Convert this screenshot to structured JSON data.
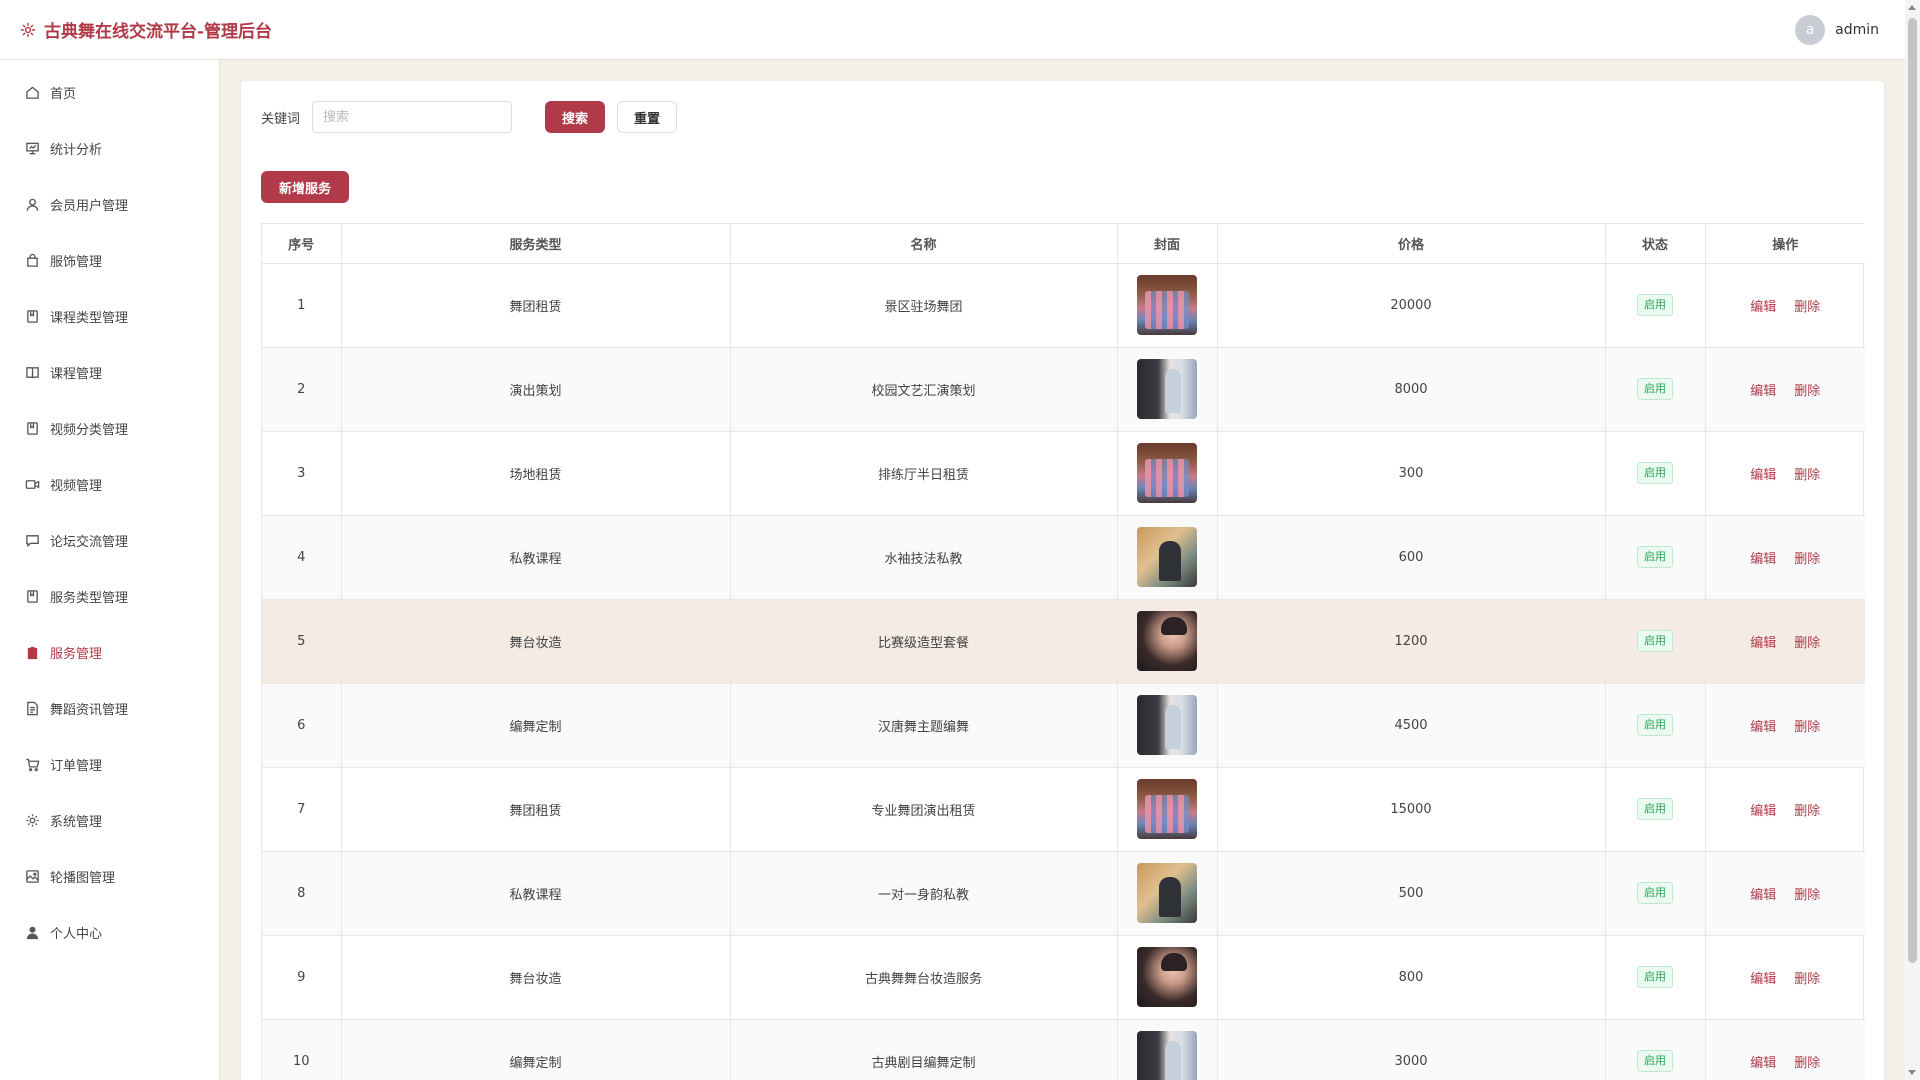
{
  "app": {
    "title": "古典舞在线交流平台-管理后台",
    "user": {
      "avatar_letter": "a",
      "name": "admin"
    },
    "accent_color": "#b03a48"
  },
  "sidebar": {
    "items": [
      {
        "label": "首页",
        "icon": "home-icon"
      },
      {
        "label": "统计分析",
        "icon": "chart-icon"
      },
      {
        "label": "会员用户管理",
        "icon": "user-icon"
      },
      {
        "label": "服饰管理",
        "icon": "bag-icon"
      },
      {
        "label": "课程类型管理",
        "icon": "bookmark-icon"
      },
      {
        "label": "课程管理",
        "icon": "book-icon"
      },
      {
        "label": "视频分类管理",
        "icon": "bookmark-icon"
      },
      {
        "label": "视频管理",
        "icon": "video-icon"
      },
      {
        "label": "论坛交流管理",
        "icon": "chat-icon"
      },
      {
        "label": "服务类型管理",
        "icon": "bookmark-icon"
      },
      {
        "label": "服务管理",
        "icon": "clipboard-icon",
        "active": true
      },
      {
        "label": "舞蹈资讯管理",
        "icon": "document-icon"
      },
      {
        "label": "订单管理",
        "icon": "cart-icon"
      },
      {
        "label": "系统管理",
        "icon": "gear-icon"
      },
      {
        "label": "轮播图管理",
        "icon": "image-icon"
      },
      {
        "label": "个人中心",
        "icon": "person-icon"
      }
    ]
  },
  "search": {
    "label": "关键词",
    "placeholder": "搜索",
    "value": "",
    "search_button": "搜索",
    "reset_button": "重置"
  },
  "toolbar": {
    "add_button": "新增服务"
  },
  "table": {
    "columns": [
      "序号",
      "服务类型",
      "名称",
      "封面",
      "价格",
      "状态",
      "操作"
    ],
    "actions": {
      "edit": "编辑",
      "delete": "删除"
    },
    "rows": [
      {
        "no": "1",
        "type": "舞团租赁",
        "name": "景区驻场舞团",
        "cover": "dance-troupe-photo",
        "price": "20000",
        "status": "启用"
      },
      {
        "no": "2",
        "type": "演出策划",
        "name": "校园文艺汇演策划",
        "cover": "studio-dancer-photo",
        "price": "8000",
        "status": "启用"
      },
      {
        "no": "3",
        "type": "场地租赁",
        "name": "排练厅半日租赁",
        "cover": "dance-troupe-photo",
        "price": "300",
        "status": "启用"
      },
      {
        "no": "4",
        "type": "私教课程",
        "name": "水袖技法私教",
        "cover": "private-lesson-photo",
        "price": "600",
        "status": "启用"
      },
      {
        "no": "5",
        "type": "舞台妆造",
        "name": "比赛级造型套餐",
        "cover": "makeup-photo",
        "price": "1200",
        "status": "启用"
      },
      {
        "no": "6",
        "type": "编舞定制",
        "name": "汉唐舞主题编舞",
        "cover": "studio-dancer-photo",
        "price": "4500",
        "status": "启用"
      },
      {
        "no": "7",
        "type": "舞团租赁",
        "name": "专业舞团演出租赁",
        "cover": "dance-troupe-photo",
        "price": "15000",
        "status": "启用"
      },
      {
        "no": "8",
        "type": "私教课程",
        "name": "一对一身韵私教",
        "cover": "private-lesson-photo",
        "price": "500",
        "status": "启用"
      },
      {
        "no": "9",
        "type": "舞台妆造",
        "name": "古典舞舞台妆造服务",
        "cover": "makeup-photo",
        "price": "800",
        "status": "启用"
      },
      {
        "no": "10",
        "type": "编舞定制",
        "name": "古典剧目编舞定制",
        "cover": "studio-dancer-photo",
        "price": "3000",
        "status": "启用"
      }
    ]
  }
}
